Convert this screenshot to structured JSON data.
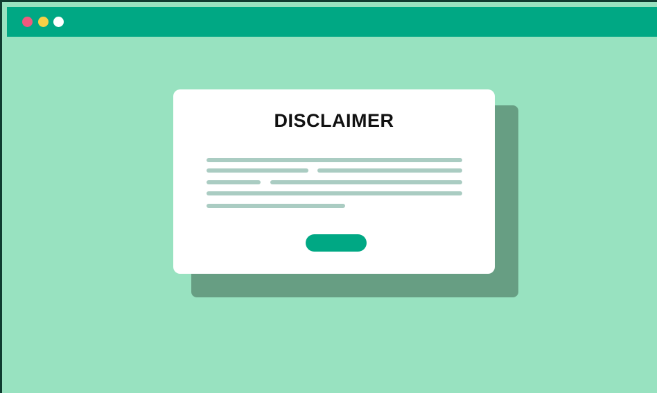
{
  "window": {
    "controls": [
      {
        "icon": "close-dot-icon",
        "color": "#f05a7e"
      },
      {
        "icon": "minimize-dot-icon",
        "color": "#f7d046"
      },
      {
        "icon": "maximize-dot-icon",
        "color": "#ffffff"
      }
    ],
    "titlebar_color": "#00a884",
    "background_color": "#98e2c0"
  },
  "dialog": {
    "title": "DISCLAIMER",
    "button_label": "",
    "button_color": "#00a884",
    "placeholder_line_color": "#aaccc2",
    "shadow_color": "#679e83"
  }
}
